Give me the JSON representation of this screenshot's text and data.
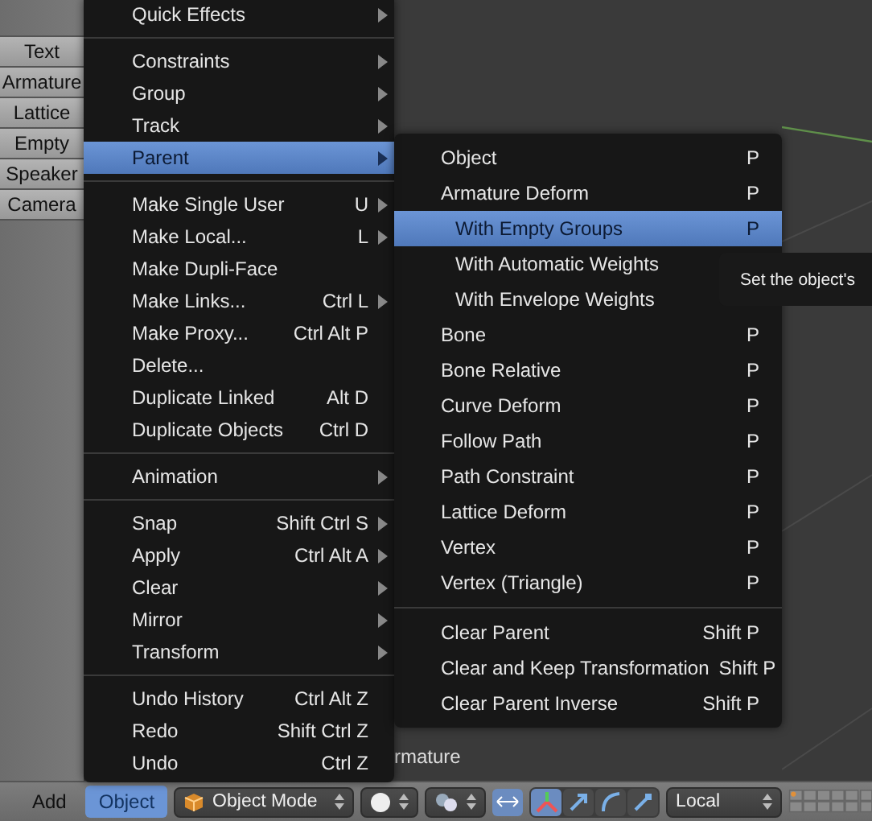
{
  "toolshelf": {
    "buttons": [
      "Text",
      "Armature",
      "Lattice",
      "Empty",
      "Speaker",
      "Camera"
    ]
  },
  "viewport": {
    "object_label": "rmature"
  },
  "object_menu": {
    "sections": [
      [
        {
          "label": "Quick Effects",
          "submenu": true,
          "selected": false
        }
      ],
      [
        {
          "label": "Constraints",
          "submenu": true,
          "selected": false
        },
        {
          "label": "Group",
          "submenu": true,
          "selected": false
        },
        {
          "label": "Track",
          "submenu": true,
          "selected": false
        },
        {
          "label": "Parent",
          "submenu": true,
          "selected": true
        }
      ],
      [
        {
          "label": "Make Single User",
          "shortcut": "U",
          "submenu": true,
          "selected": false
        },
        {
          "label": "Make Local...",
          "shortcut": "L",
          "submenu": true,
          "selected": false
        },
        {
          "label": "Make Dupli-Face",
          "submenu": false,
          "selected": false
        },
        {
          "label": "Make Links...",
          "shortcut": "Ctrl L",
          "submenu": true,
          "selected": false
        },
        {
          "label": "Make Proxy...",
          "shortcut": "Ctrl Alt P",
          "submenu": false,
          "selected": false
        },
        {
          "label": "Delete...",
          "submenu": false,
          "selected": false
        },
        {
          "label": "Duplicate Linked",
          "shortcut": "Alt D",
          "submenu": false,
          "selected": false
        },
        {
          "label": "Duplicate Objects",
          "shortcut": "Ctrl D",
          "submenu": false,
          "selected": false
        }
      ],
      [
        {
          "label": "Animation",
          "submenu": true,
          "selected": false
        }
      ],
      [
        {
          "label": "Snap",
          "shortcut": "Shift Ctrl S",
          "submenu": true,
          "selected": false
        },
        {
          "label": "Apply",
          "shortcut": "Ctrl Alt A",
          "submenu": true,
          "selected": false
        },
        {
          "label": "Clear",
          "submenu": true,
          "selected": false
        },
        {
          "label": "Mirror",
          "submenu": true,
          "selected": false
        },
        {
          "label": "Transform",
          "submenu": true,
          "selected": false
        }
      ],
      [
        {
          "label": "Undo History",
          "shortcut": "Ctrl Alt Z",
          "submenu": false,
          "selected": false
        },
        {
          "label": "Redo",
          "shortcut": "Shift Ctrl Z",
          "submenu": false,
          "selected": false
        },
        {
          "label": "Undo",
          "shortcut": "Ctrl Z",
          "submenu": false,
          "selected": false
        }
      ]
    ]
  },
  "parent_menu": {
    "sections": [
      [
        {
          "label": "Object",
          "shortcut": "P",
          "nested": false,
          "selected": false
        },
        {
          "label": "Armature Deform",
          "shortcut": "P",
          "nested": false,
          "selected": false
        },
        {
          "label": "With Empty Groups",
          "shortcut": "P",
          "nested": true,
          "selected": true
        },
        {
          "label": "With Automatic Weights",
          "nested": true,
          "selected": false
        },
        {
          "label": "With Envelope Weights",
          "nested": true,
          "selected": false
        },
        {
          "label": "Bone",
          "shortcut": "P",
          "nested": false,
          "selected": false
        },
        {
          "label": "Bone Relative",
          "shortcut": "P",
          "nested": false,
          "selected": false
        },
        {
          "label": "Curve Deform",
          "shortcut": "P",
          "nested": false,
          "selected": false
        },
        {
          "label": "Follow Path",
          "shortcut": "P",
          "nested": false,
          "selected": false
        },
        {
          "label": "Path Constraint",
          "shortcut": "P",
          "nested": false,
          "selected": false
        },
        {
          "label": "Lattice Deform",
          "shortcut": "P",
          "nested": false,
          "selected": false
        },
        {
          "label": "Vertex",
          "shortcut": "P",
          "nested": false,
          "selected": false
        },
        {
          "label": "Vertex (Triangle)",
          "shortcut": "P",
          "nested": false,
          "selected": false
        }
      ],
      [
        {
          "label": "Clear Parent",
          "shortcut": "Shift P",
          "nested": false,
          "selected": false
        },
        {
          "label": "Clear and Keep Transformation",
          "shortcut": "Shift P",
          "nested": false,
          "selected": false
        },
        {
          "label": "Clear Parent Inverse",
          "shortcut": "Shift P",
          "nested": false,
          "selected": false
        }
      ]
    ]
  },
  "tooltip": {
    "text": "Set the object's"
  },
  "header": {
    "menus": [
      {
        "label": "Add",
        "selected": false
      },
      {
        "label": "Object",
        "selected": true
      }
    ],
    "mode": "Object Mode",
    "orientation": "Local"
  }
}
